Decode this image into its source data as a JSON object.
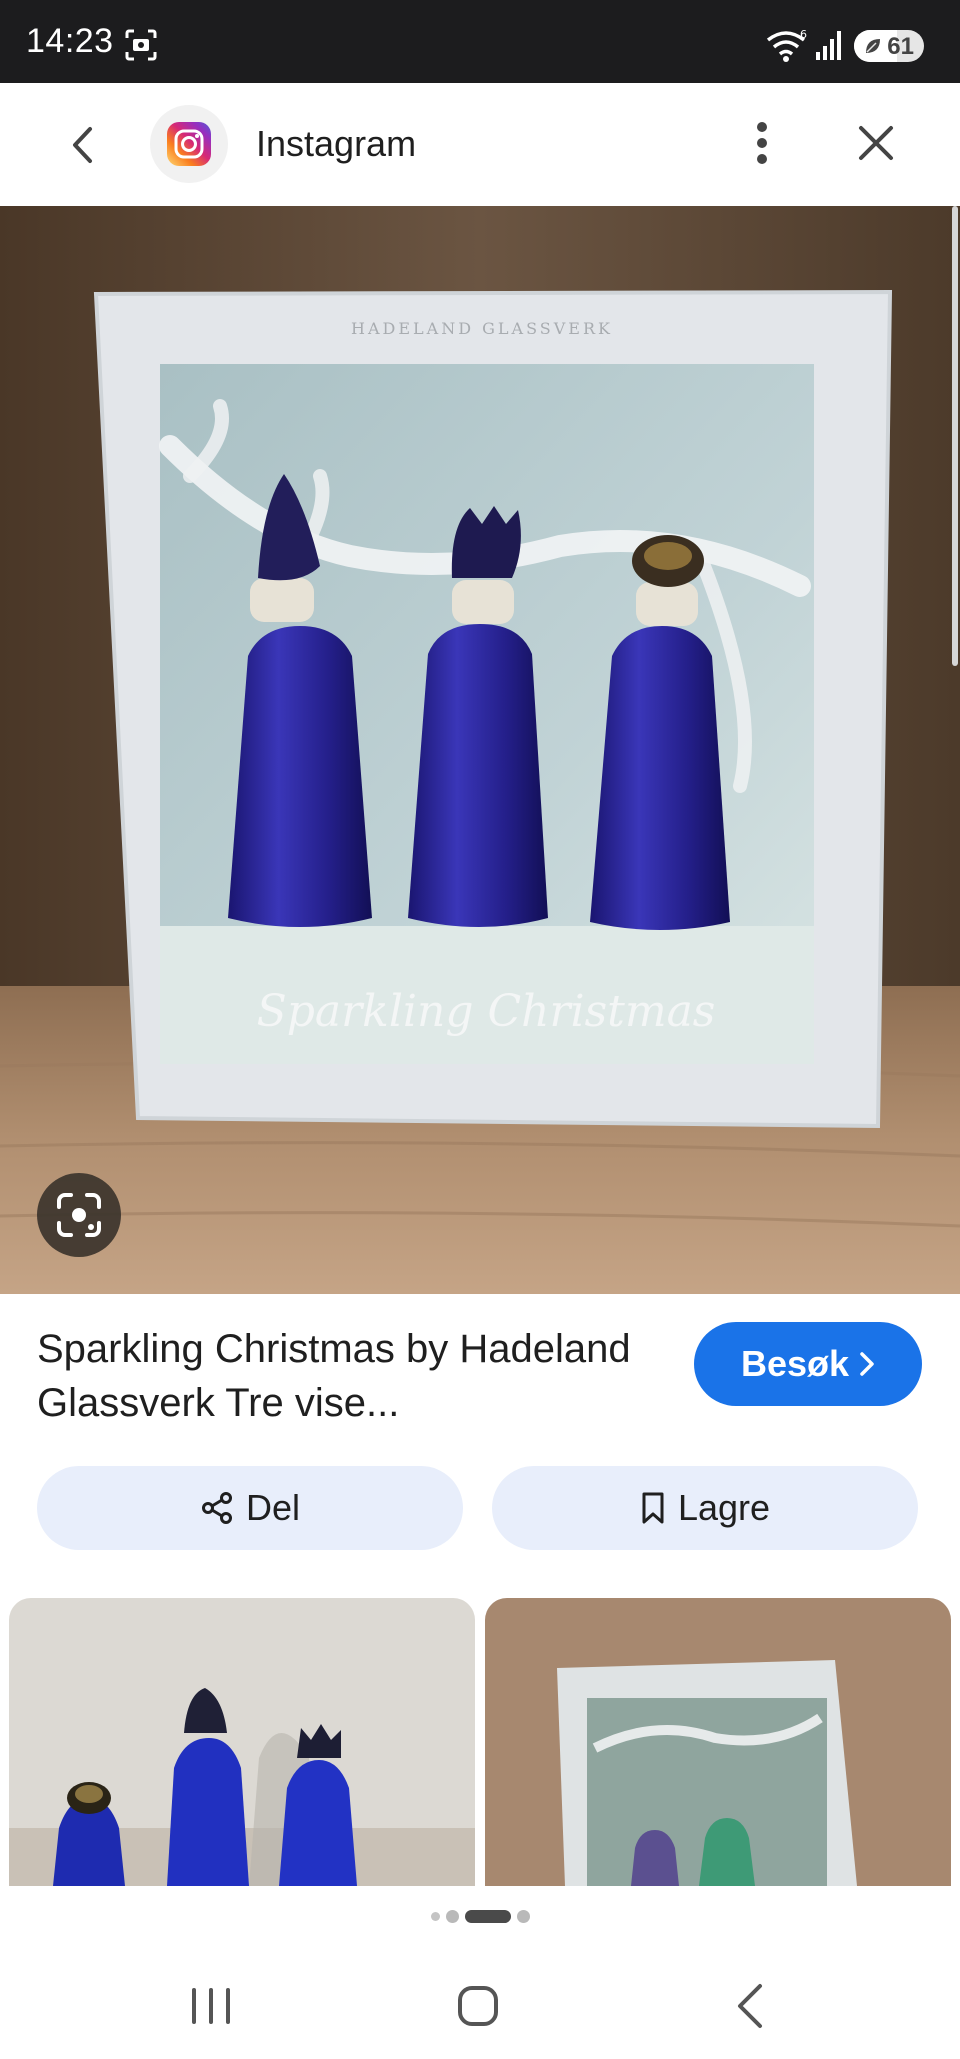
{
  "status_bar": {
    "time": "14:23",
    "battery": "61",
    "battery_level": 0.61
  },
  "header": {
    "site_name": "Instagram",
    "icons": [
      "back-icon",
      "instagram-logo",
      "more-vert-icon",
      "close-icon"
    ]
  },
  "main_image": {
    "box_brand_text": "HADELAND GLASSVERK",
    "box_script_text": "Sparkling Christmas"
  },
  "result": {
    "title": "Sparkling Christmas by Hadeland Glassverk Tre vise...",
    "visit_label": "Besøk",
    "share_label": "Del",
    "save_label": "Lagre"
  },
  "pager": {
    "count": 5,
    "active_index": 2
  },
  "colors": {
    "accent": "#1a73e8",
    "action_bg": "#e8eefb",
    "status_bar_bg": "#1c1c1e"
  }
}
